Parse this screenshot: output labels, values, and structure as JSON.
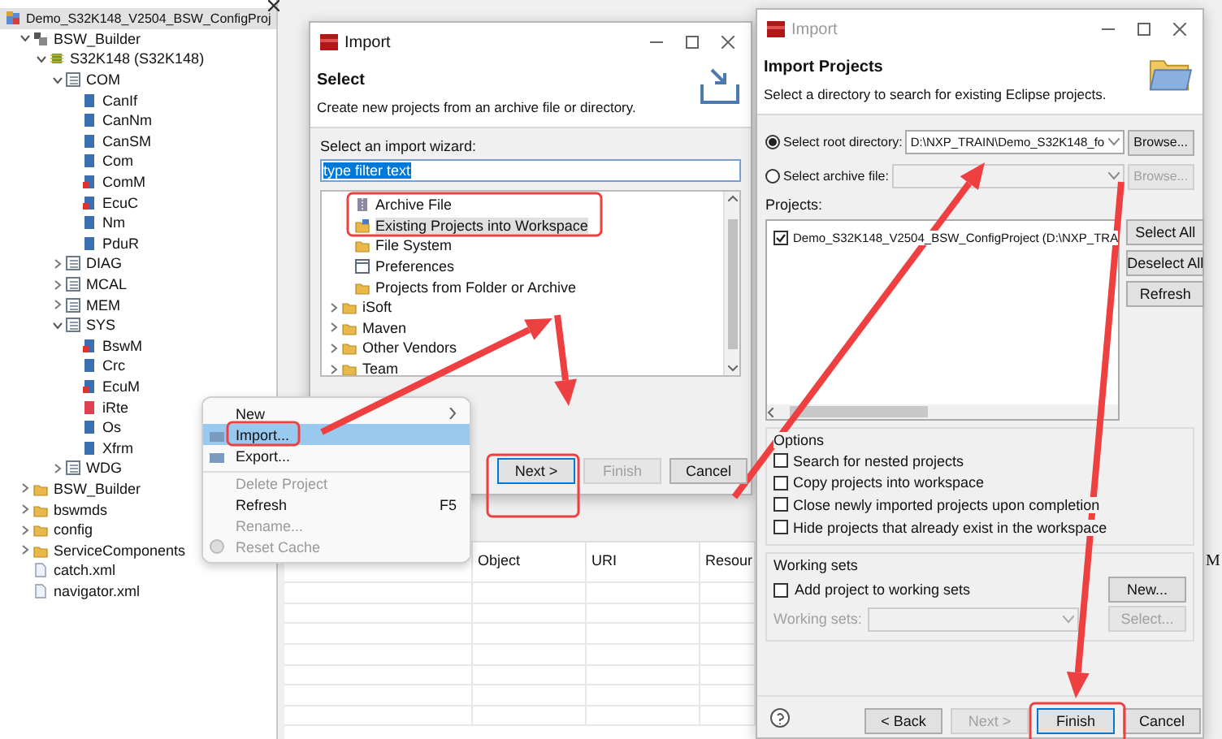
{
  "project_explorer": {
    "root": {
      "label": "Demo_S32K148_V2504_BSW_ConfigProj",
      "selected": true,
      "children": [
        {
          "label": "BSW_Builder",
          "kind": "builder",
          "expanded": true,
          "children": [
            {
              "label": "S32K148 (S32K148)",
              "kind": "chip",
              "expanded": true,
              "children": [
                {
                  "label": "COM",
                  "kind": "group",
                  "expanded": true,
                  "children": [
                    {
                      "label": "CanIf",
                      "kind": "module"
                    },
                    {
                      "label": "CanNm",
                      "kind": "module"
                    },
                    {
                      "label": "CanSM",
                      "kind": "module"
                    },
                    {
                      "label": "Com",
                      "kind": "module"
                    },
                    {
                      "label": "ComM",
                      "kind": "module-error"
                    },
                    {
                      "label": "EcuC",
                      "kind": "module-error"
                    },
                    {
                      "label": "Nm",
                      "kind": "module"
                    },
                    {
                      "label": "PduR",
                      "kind": "module"
                    }
                  ]
                },
                {
                  "label": "DIAG",
                  "kind": "group",
                  "expanded": false
                },
                {
                  "label": "MCAL",
                  "kind": "group",
                  "expanded": false
                },
                {
                  "label": "MEM",
                  "kind": "group",
                  "expanded": false
                },
                {
                  "label": "SYS",
                  "kind": "group",
                  "expanded": true,
                  "children": [
                    {
                      "label": "BswM",
                      "kind": "module-error"
                    },
                    {
                      "label": "Crc",
                      "kind": "module"
                    },
                    {
                      "label": "EcuM",
                      "kind": "module-error"
                    },
                    {
                      "label": "iRte",
                      "kind": "rte"
                    },
                    {
                      "label": "Os",
                      "kind": "module"
                    },
                    {
                      "label": "Xfrm",
                      "kind": "module"
                    }
                  ]
                },
                {
                  "label": "WDG",
                  "kind": "group",
                  "expanded": false
                }
              ]
            }
          ]
        },
        {
          "label": "BSW_Builder",
          "kind": "folder",
          "expanded": false
        },
        {
          "label": "bswmds",
          "kind": "folder",
          "expanded": false
        },
        {
          "label": "config",
          "kind": "folder",
          "expanded": false
        },
        {
          "label": "ServiceComponents",
          "kind": "folder",
          "expanded": false
        },
        {
          "label": "catch.xml",
          "kind": "file"
        },
        {
          "label": "navigator.xml",
          "kind": "file"
        }
      ]
    }
  },
  "background_table": {
    "columns": [
      "Object",
      "URI",
      "Resour"
    ],
    "edge_label": "M"
  },
  "context_menu": {
    "items": [
      {
        "label": "New",
        "kind": "plain",
        "submenu": true,
        "disabled": false,
        "selected": false
      },
      {
        "label": "Import...",
        "kind": "import",
        "disabled": false,
        "selected": true
      },
      {
        "label": "Export...",
        "kind": "export",
        "disabled": false,
        "selected": false
      },
      {
        "label": "Delete Project",
        "kind": "plain",
        "disabled": true,
        "selected": false,
        "separator_before": true
      },
      {
        "label": "Refresh",
        "kind": "plain",
        "shortcut": "F5",
        "disabled": false,
        "selected": false
      },
      {
        "label": "Rename...",
        "kind": "plain",
        "disabled": true,
        "selected": false
      },
      {
        "label": "Reset Cache",
        "kind": "reset",
        "disabled": true,
        "selected": false
      }
    ]
  },
  "select_dialog": {
    "title": "Import",
    "heading": "Select",
    "description": "Create new projects from an archive file or directory.",
    "wizard_label": "Select an import wizard:",
    "filter": {
      "value": "type filter text",
      "text_selected": true
    },
    "general_items": [
      {
        "label": "Archive File",
        "kind": "archive",
        "selected": false
      },
      {
        "label": "Existing Projects into Workspace",
        "kind": "project-folder",
        "selected": true
      },
      {
        "label": "File System",
        "kind": "folder",
        "selected": false
      },
      {
        "label": "Preferences",
        "kind": "preferences",
        "selected": false
      },
      {
        "label": "Projects from Folder or Archive",
        "kind": "folder",
        "selected": false
      }
    ],
    "groups": [
      {
        "label": "iSoft",
        "expanded": false
      },
      {
        "label": "Maven",
        "expanded": false
      },
      {
        "label": "Other Vendors",
        "expanded": false
      },
      {
        "label": "Team",
        "expanded": false
      }
    ],
    "buttons": [
      {
        "label": "Next >",
        "default": true,
        "disabled": false
      },
      {
        "label": "Finish",
        "default": false,
        "disabled": true
      },
      {
        "label": "Cancel",
        "default": false,
        "disabled": false
      }
    ]
  },
  "import_projects_dialog": {
    "title": "Import",
    "active": false,
    "heading": "Import Projects",
    "description": "Select a directory to search for existing Eclipse projects.",
    "sources": [
      {
        "label": "Select root directory:",
        "selected": true,
        "value": "D:\\NXP_TRAIN\\Demo_S32K148_fo",
        "browse": "Browse...",
        "disabled": false
      },
      {
        "label": "Select archive file:",
        "selected": false,
        "browse": "Browse...",
        "disabled": true
      }
    ],
    "projects_label": "Projects:",
    "projects": [
      {
        "label": "Demo_S32K148_V2504_BSW_ConfigProject (D:\\NXP_TRA",
        "checked": true
      }
    ],
    "side_buttons": [
      "Select All",
      "Deselect All",
      "Refresh"
    ],
    "options": {
      "title": "Options",
      "items": [
        {
          "label": "Search for nested projects",
          "checked": false
        },
        {
          "label": "Copy projects into workspace",
          "checked": false
        },
        {
          "label": "Close newly imported projects upon completion",
          "checked": false
        },
        {
          "label": "Hide projects that already exist in the workspace",
          "checked": false
        }
      ]
    },
    "working_sets": {
      "title": "Working sets",
      "add": {
        "label": "Add project to working sets",
        "checked": false
      },
      "new_button": "New...",
      "sets_label": "Working sets:",
      "select_button": "Select...",
      "disabled": true
    },
    "buttons": [
      {
        "label": "< Back",
        "default": false,
        "disabled": false
      },
      {
        "label": "Next >",
        "default": false,
        "disabled": true
      },
      {
        "label": "Finish",
        "default": true,
        "disabled": false
      },
      {
        "label": "Cancel",
        "default": false,
        "disabled": false
      }
    ]
  }
}
